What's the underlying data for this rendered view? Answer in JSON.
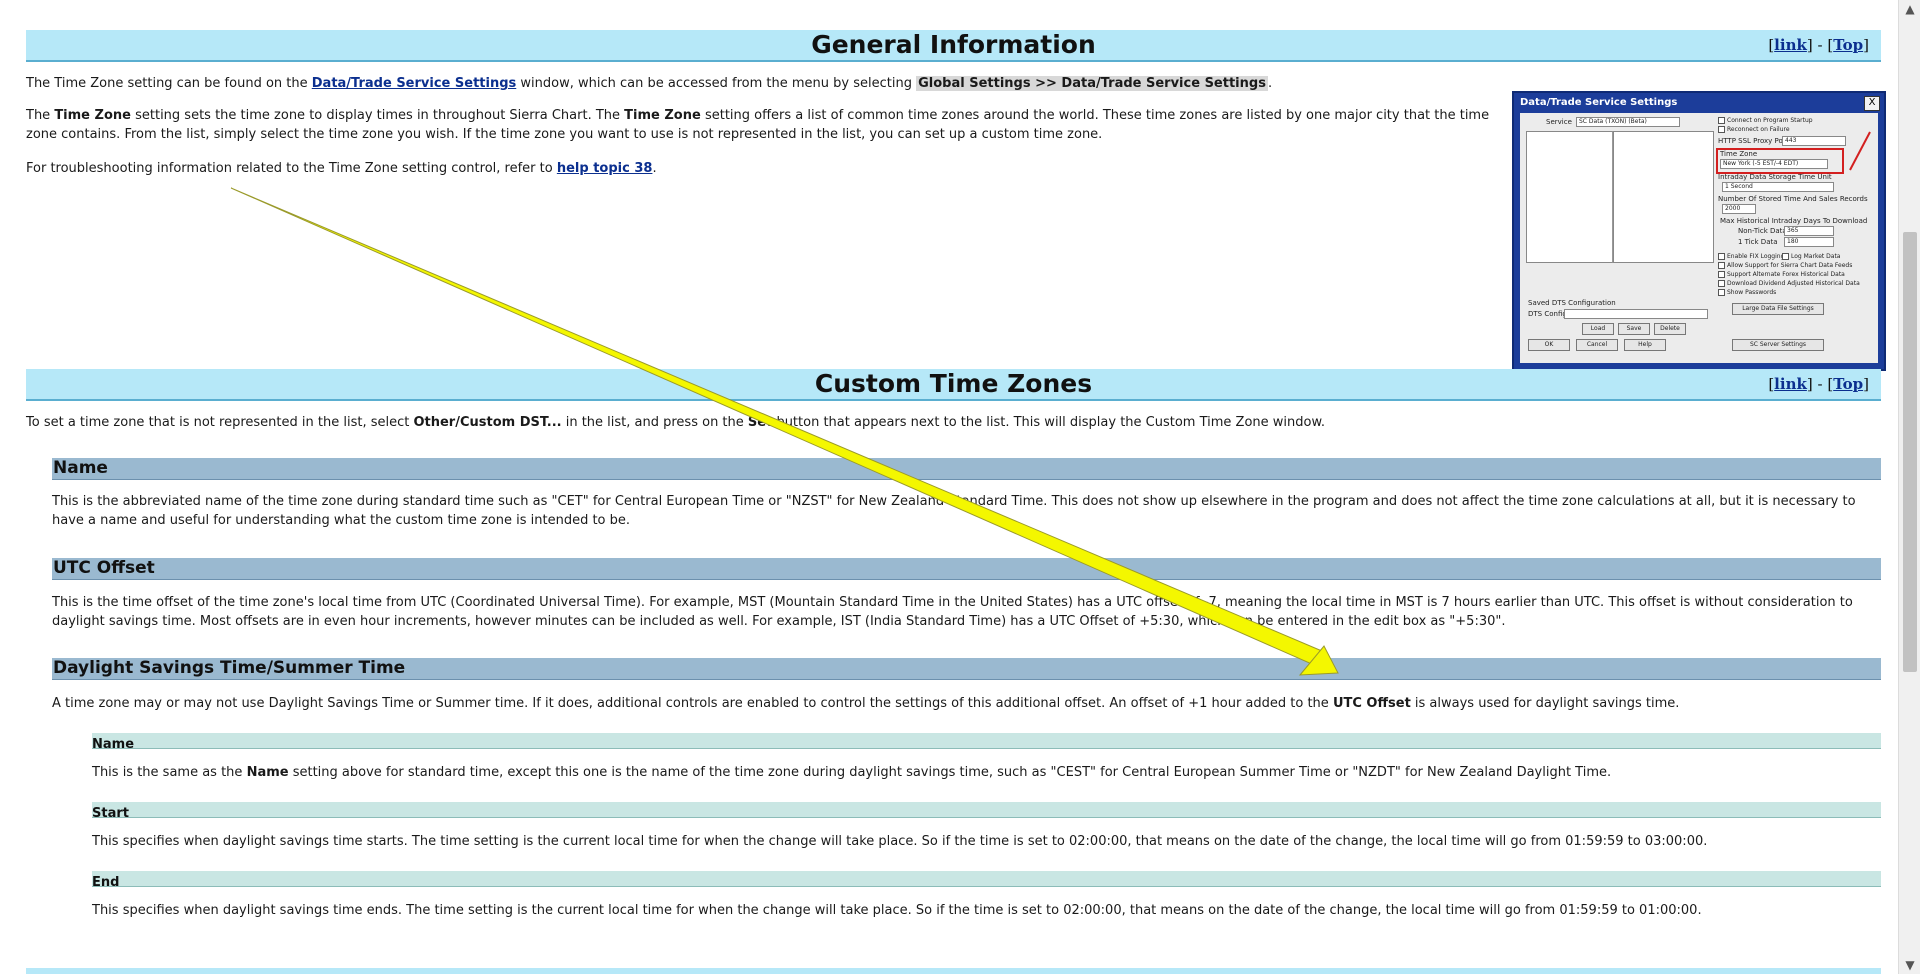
{
  "sections": {
    "general": {
      "title": "General Information",
      "link_label": "link",
      "top_label": "Top",
      "sep": "-",
      "p1_pre": "The Time Zone setting can be found on the ",
      "p1_link": "Data/Trade Service Settings",
      "p1_mid": " window, which can be accessed from the menu by selecting ",
      "p1_hl": "Global Settings >> Data/Trade Service Settings",
      "p1_end": ".",
      "p2_pre": "The ",
      "p2_b1": "Time Zone",
      "p2_mid": " setting sets the time zone to display times in throughout Sierra Chart. The ",
      "p2_b2": "Time Zone",
      "p2_end": " setting offers a list of common time zones around the world. These time zones are listed by one major city that the time zone contains. From the list, simply select the time zone you wish. If the time zone you want to use is not represented in the list, you can set up a custom time zone.",
      "p3_pre": "For troubleshooting information related to the Time Zone setting control, refer to ",
      "p3_link": "help topic 38",
      "p3_end": "."
    },
    "custom": {
      "title": "Custom Time Zones",
      "link_label": "link",
      "top_label": "Top",
      "sep": "-",
      "intro_pre": "To set a time zone that is not represented in the list, select ",
      "intro_b1": "Other/Custom DST...",
      "intro_mid": " in the list, and press on the ",
      "intro_b2": "Set",
      "intro_end": " button that appears next to the list. This will display the Custom Time Zone window."
    },
    "name": {
      "title": "Name",
      "text": "This is the abbreviated name of the time zone during standard time such as \"CET\" for Central European Time or \"NZST\" for New Zealand Standard Time. This does not show up elsewhere in the program and does not affect the time zone calculations at all, but it is necessary to have a name and useful for understanding what the custom time zone is intended to be."
    },
    "utc": {
      "title": "UTC Offset",
      "text": "This is the time offset of the time zone's local time from UTC (Coordinated Universal Time). For example, MST (Mountain Standard Time in the United States) has a UTC offset of -7, meaning the local time in MST is 7 hours earlier than UTC. This offset is without consideration to daylight savings time. Most offsets are in even hour increments, however minutes can be included as well. For example, IST (India Standard Time) has a UTC Offset of +5:30, which can be entered in the edit box as \"+5:30\"."
    },
    "dst": {
      "title": "Daylight Savings Time/Summer Time",
      "text_pre": "A time zone may or may not use Daylight Savings Time or Summer time. If it does, additional controls are enabled to control the settings of this additional offset. An offset of +1 hour added to the ",
      "text_b": "UTC Offset",
      "text_end": " is always used for daylight savings time."
    },
    "dst_name": {
      "title": "Name",
      "text_pre": "This is the same as the ",
      "text_b": "Name",
      "text_end": " setting above for standard time, except this one is the name of the time zone during daylight savings time, such as \"CEST\" for Central European Summer Time or \"NZDT\" for New Zealand Daylight Time."
    },
    "dst_start": {
      "title": "Start",
      "text": "This specifies when daylight savings time starts. The time setting is the current local time for when the change will take place. So if the time is set to 02:00:00, that means on the date of the change, the local time will go from 01:59:59 to 03:00:00."
    },
    "dst_end": {
      "title": "End",
      "text": "This specifies when daylight savings time ends. The time setting is the current local time for when the change will take place. So if the time is set to 02:00:00, that means on the date of the change, the local time will go from 01:59:59 to 01:00:00."
    }
  },
  "dialog": {
    "title": "Data/Trade Service Settings",
    "close": "X",
    "service_label": "Service",
    "service_value": "SC Data (TXON) (Beta)",
    "time_zone_label": "Time Zone",
    "time_zone_value": "New York (-5 EST/-4 EDT)",
    "intraday_label": "Intraday Data Storage Time Unit",
    "intraday_value": "1 Second",
    "stored_label": "Number Of Stored Time And Sales Records",
    "stored_value": "2000",
    "max_label": "Max Historical Intraday Days To Download",
    "nontick_label": "Non-Tick Data",
    "nontick_value": "365",
    "tick_label": "1 Tick Data",
    "tick_value": "180",
    "proxy_label": "HTTP SSL Proxy Port",
    "proxy_value": "443",
    "chk1": "Connect on Program Startup",
    "chk2": "Reconnect on Failure",
    "chk3": "Enable FIX Logging",
    "chk3b": "Log Market Data",
    "chk4": "Allow Support for Sierra Chart Data Feeds",
    "chk5": "Support Alternate Forex Historical Data",
    "chk6": "Download Dividend Adjusted Historical Data",
    "chk7": "Show Passwords",
    "saved_label": "Saved DTS Configuration",
    "dts_label": "DTS Config",
    "btn_load": "Load",
    "btn_save": "Save",
    "btn_delete": "Delete",
    "btn_large": "Large Data File Settings",
    "btn_ok": "OK",
    "btn_cancel": "Cancel",
    "btn_help": "Help",
    "btn_server": "SC Server Settings"
  },
  "scrollbar": {
    "up": "▲",
    "down": "▼",
    "scroll_fraction": 0.35
  },
  "colors": {
    "section_bar": "#b6e8f8",
    "sub_bar": "#9ab9d0",
    "subsub_bar": "#c9e6e3",
    "arrow": "#f4f700",
    "link": "#0b2f8f"
  }
}
